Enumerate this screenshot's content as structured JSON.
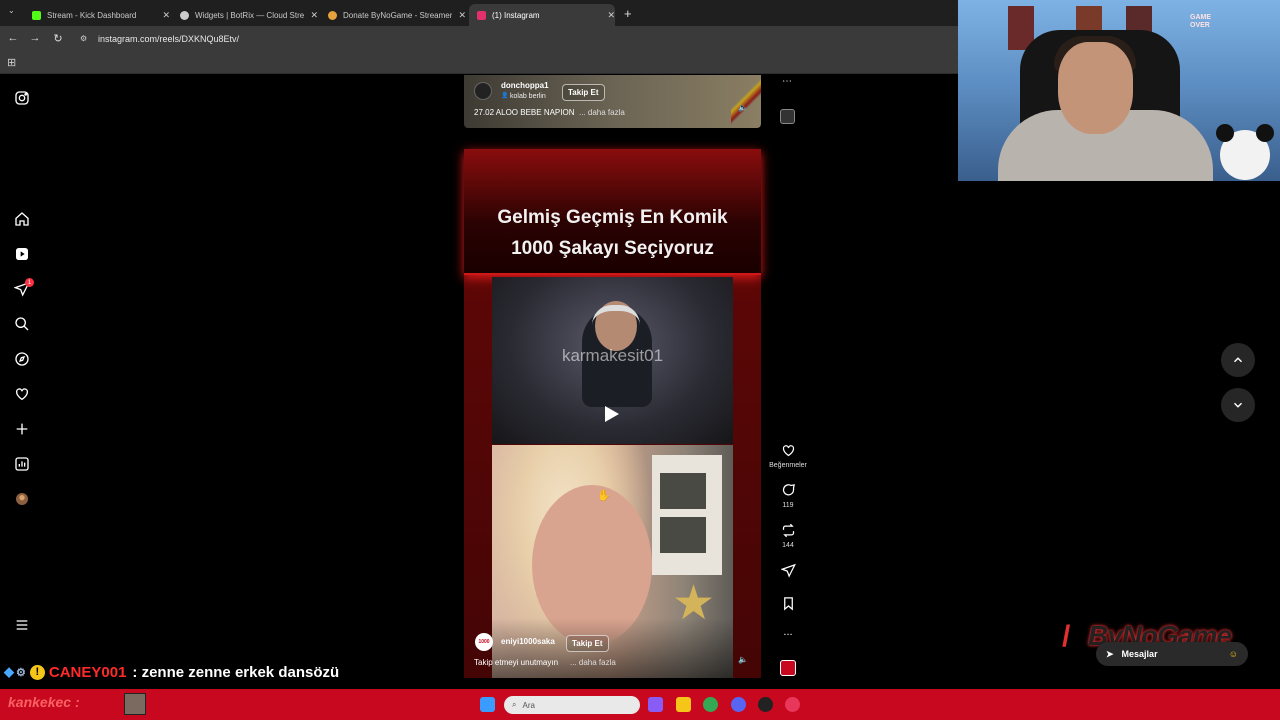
{
  "browser": {
    "tabs": [
      {
        "title": "Stream - Kick Dashboard",
        "favicon_color": "#53fc18"
      },
      {
        "title": "Widgets | BotRix — Cloud Stre...",
        "favicon_color": "#cccccc"
      },
      {
        "title": "Donate ByNoGame - Streamer",
        "favicon_color": "#e6a23c"
      },
      {
        "title": "(1) Instagram",
        "favicon_color": "#e1306c"
      }
    ],
    "new_tab_label": "+",
    "url": "instagram.com/reels/DXKNQu8Etv/"
  },
  "sidebar": {
    "items": [
      "instagram-logo",
      "home",
      "reels",
      "messages",
      "search",
      "explore",
      "notifications",
      "create",
      "dashboard",
      "profile",
      "more"
    ],
    "notification_count": "1"
  },
  "prev_reel": {
    "username": "donchoppa1",
    "subline": "kolab berlin",
    "follow_label": "Takip Et",
    "caption": "27.02 ALOO BEBE NAPION",
    "more_label": "... daha fazla"
  },
  "reel": {
    "title_line1": "Gelmiş Geçmiş En Komik",
    "title_line2": "1000 Şakayı Seçiyoruz",
    "watermark": "karmakesit01",
    "username": "eniyi1000saka",
    "follow_label": "Takip Et",
    "caption": "Takip etmeyi unutmayın",
    "more_label": "... daha fazla",
    "avatar_text": "1000"
  },
  "actions": {
    "likes_label": "Beğenmeler",
    "comments_count": "119",
    "reposts_count": "144",
    "more_dots": "..."
  },
  "overlay": {
    "brand": "ByNoGame",
    "messages_label": "Mesajlar",
    "chat_user": "CANEY001",
    "chat_message": ": zenne zenne erkek dansözü",
    "ticker_text": "kankekec :"
  },
  "taskbar": {
    "search_placeholder": "Ara"
  },
  "colors": {
    "taskbar": "#c8081e",
    "reel_bg": "#5a0606",
    "badge": "#ff3040"
  }
}
